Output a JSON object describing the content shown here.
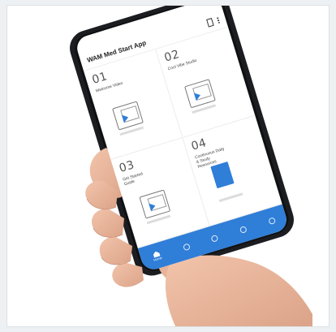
{
  "app": {
    "title": "WAM Med Start App",
    "cards": [
      {
        "number": "01",
        "label": "Welcome Video",
        "type": "video"
      },
      {
        "number": "02",
        "label": "Cool Vibe Studio",
        "type": "video"
      },
      {
        "number": "03",
        "label": "Get Started Guide",
        "type": "video"
      },
      {
        "number": "04",
        "label": "Continuous Daily & Study Resources",
        "type": "document"
      }
    ],
    "nav": [
      {
        "label": "Home",
        "icon": "home-icon"
      },
      {
        "label": "",
        "icon": "calendar-icon"
      },
      {
        "label": "",
        "icon": "search-icon"
      },
      {
        "label": "",
        "icon": "profile-icon"
      },
      {
        "label": "",
        "icon": "more-icon"
      }
    ]
  },
  "colors": {
    "accent": "#2f7ed8",
    "phone_frame": "#1c1d21",
    "skin": "#e8b49a"
  }
}
